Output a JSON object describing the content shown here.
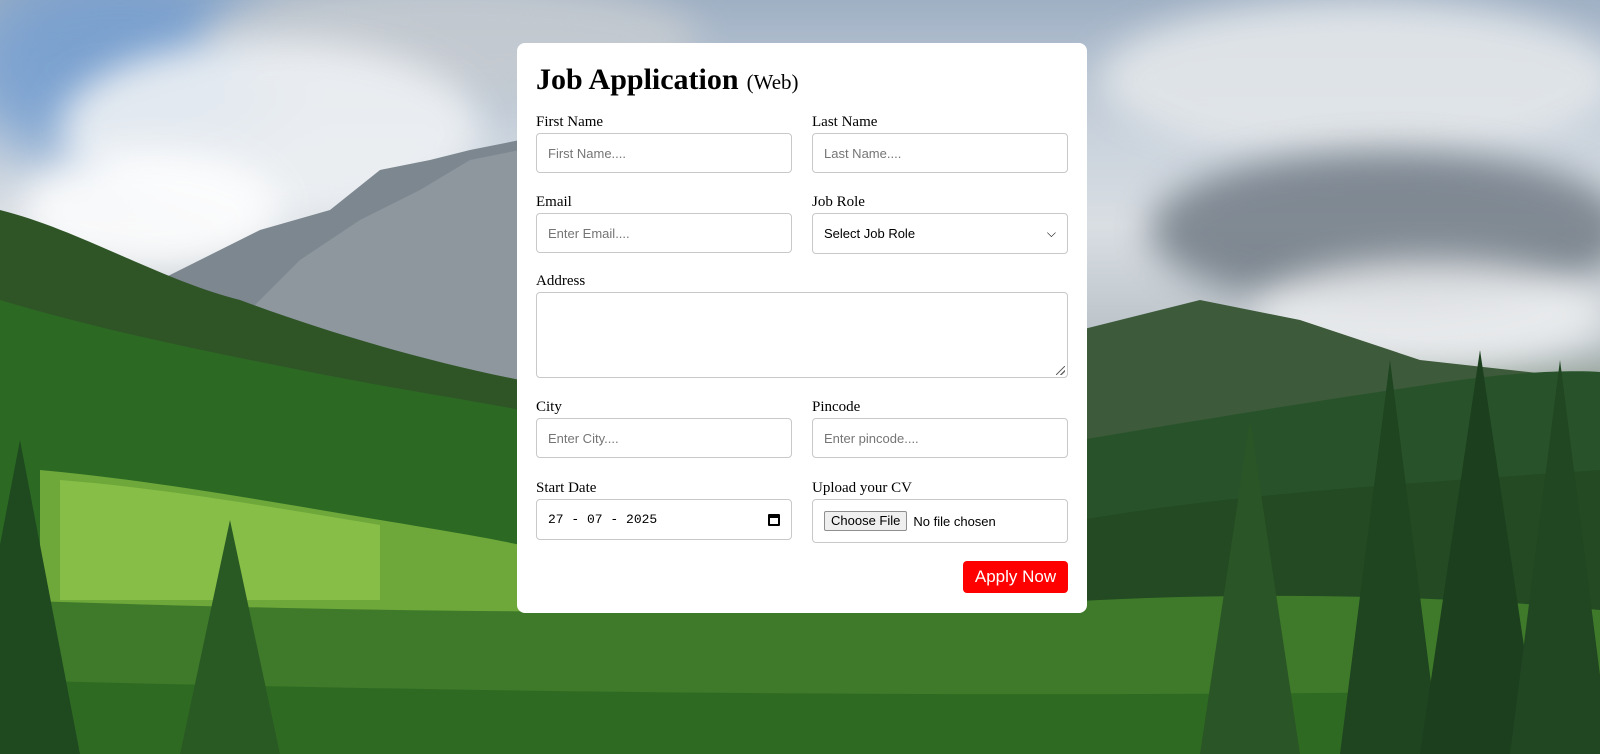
{
  "form": {
    "title": "Job Application",
    "subtitle": "(Web)",
    "first_name": {
      "label": "First Name",
      "placeholder": "First Name...."
    },
    "last_name": {
      "label": "Last Name",
      "placeholder": "Last Name...."
    },
    "email": {
      "label": "Email",
      "placeholder": "Enter Email...."
    },
    "job_role": {
      "label": "Job Role",
      "selected": "Select Job Role"
    },
    "address": {
      "label": "Address"
    },
    "city": {
      "label": "City",
      "placeholder": "Enter City...."
    },
    "pincode": {
      "label": "Pincode",
      "placeholder": "Enter pincode...."
    },
    "start_date": {
      "label": "Start Date",
      "value": "27 - 07 - 2025"
    },
    "cv": {
      "label": "Upload your CV",
      "button": "Choose File",
      "status": "No file chosen"
    },
    "submit_label": "Apply Now"
  },
  "colors": {
    "submit_bg": "#ff0000",
    "card_bg": "#ffffff"
  },
  "icons": {
    "select": "chevron-down-icon",
    "date": "calendar-icon",
    "textarea": "resize-grip-icon"
  }
}
